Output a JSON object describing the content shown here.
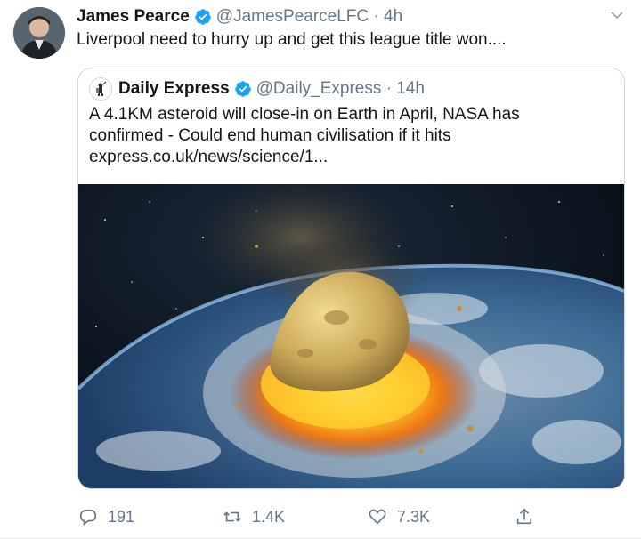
{
  "tweet": {
    "author_name": "James Pearce",
    "handle_time": "@JamesPearceLFC · 4h",
    "text": "Liverpool need to hurry up and get this league title won...."
  },
  "quoted": {
    "author_name": "Daily Express",
    "handle_time": "@Daily_Express · 14h",
    "text_lines": [
      "A 4.1KM asteroid will close-in on Earth in April, NASA has",
      "confirmed - Could end human civilisation if it hits",
      "express.co.uk/news/science/1..."
    ]
  },
  "actions": {
    "replies": "191",
    "retweets": "1.4K",
    "likes": "7.3K"
  },
  "colors": {
    "verified": "#1da1f2",
    "secondary_text": "#657786",
    "border": "#cfd9de"
  },
  "icons": [
    "verified-badge-icon",
    "chevron-down-icon",
    "reply-icon",
    "retweet-icon",
    "like-icon",
    "share-icon"
  ]
}
